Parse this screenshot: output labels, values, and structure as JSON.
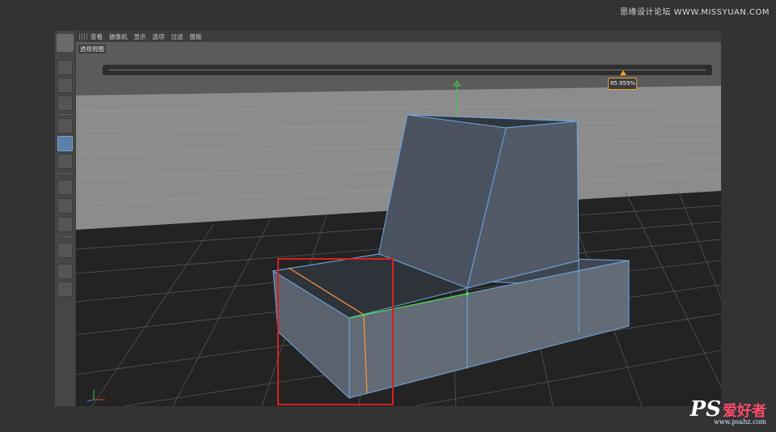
{
  "watermark": {
    "top_text": "思缘设计论坛 WWW.MISSYUAN.COM"
  },
  "menu": {
    "items": [
      "查看",
      "摄像机",
      "显示",
      "选项",
      "过滤",
      "面板"
    ]
  },
  "viewport": {
    "label": "透视视图"
  },
  "slider": {
    "value_text": "85.959%",
    "value": 0.86
  },
  "toolbar": {
    "icons": [
      "model-mode-icon",
      "texture-mode-icon",
      "workplane-icon",
      "points-mode-icon",
      "edges-mode-icon",
      "polygons-mode-icon",
      "axis-mode-icon",
      "tweak-mode-icon",
      "snap-icon",
      "magnet-icon",
      "lock-workplane-icon",
      "planar-workplane-icon"
    ]
  },
  "logo": {
    "ps": "PS",
    "cn": "爱好者",
    "url": "www.psahz.com"
  },
  "colors": {
    "accent": "#f0a020",
    "selection": "#d62020",
    "edge": "#6fa8e0",
    "selected_edge": "#ff9a3c",
    "green_edge": "#43e04a"
  }
}
